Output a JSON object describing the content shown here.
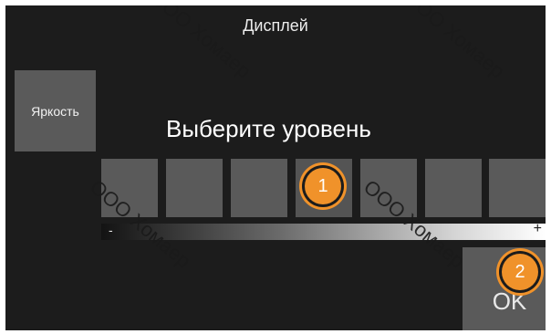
{
  "screen": {
    "title": "Дисплей",
    "side_button_label": "Яркость",
    "prompt": "Выберите уровень",
    "levels": [
      {
        "index": 1,
        "selected": false
      },
      {
        "index": 2,
        "selected": false
      },
      {
        "index": 3,
        "selected": false
      },
      {
        "index": 4,
        "selected": true
      },
      {
        "index": 5,
        "selected": false
      },
      {
        "index": 6,
        "selected": false
      },
      {
        "index": 7,
        "selected": false
      }
    ],
    "slider": {
      "min_label": "-",
      "max_label": "+"
    },
    "ok_label": "OK"
  },
  "callouts": {
    "first": "1",
    "second": "2",
    "color": "#f0922a"
  },
  "watermark": "ООО Хомаер"
}
